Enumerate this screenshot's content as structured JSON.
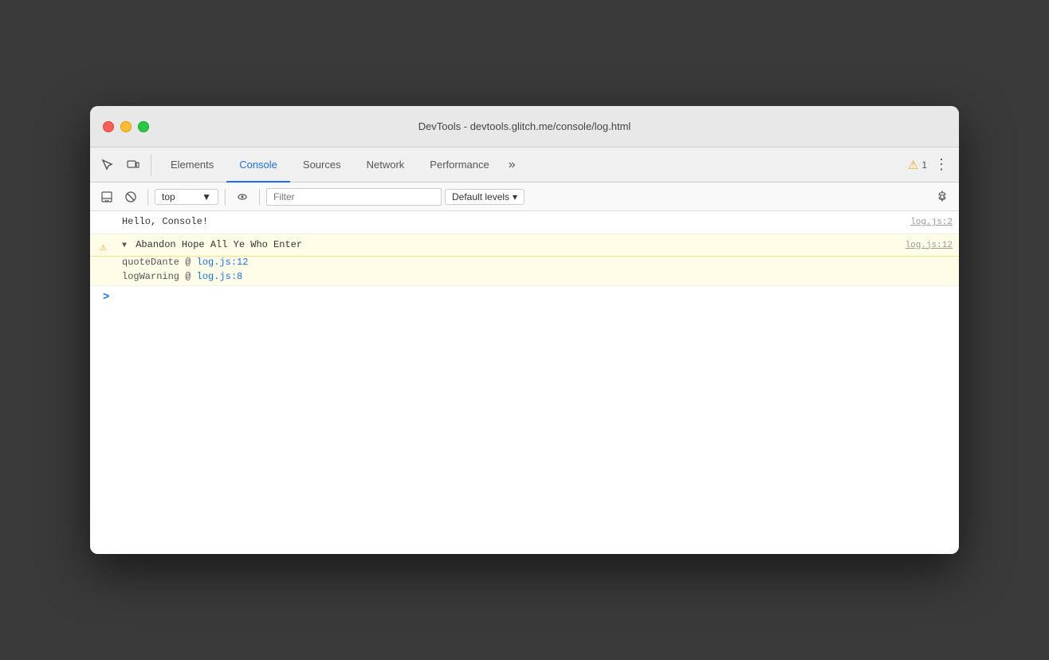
{
  "window": {
    "title": "DevTools - devtools.glitch.me/console/log.html"
  },
  "tabs": {
    "items": [
      {
        "id": "elements",
        "label": "Elements",
        "active": false
      },
      {
        "id": "console",
        "label": "Console",
        "active": true
      },
      {
        "id": "sources",
        "label": "Sources",
        "active": false
      },
      {
        "id": "network",
        "label": "Network",
        "active": false
      },
      {
        "id": "performance",
        "label": "Performance",
        "active": false
      }
    ],
    "more_label": "»",
    "warning_count": "1",
    "more_options_label": "⋮"
  },
  "console_toolbar": {
    "context_value": "top",
    "context_dropdown": "▼",
    "filter_placeholder": "Filter",
    "levels_label": "Default levels",
    "levels_dropdown": "▾"
  },
  "console_entries": [
    {
      "type": "info",
      "text": "Hello, Console!",
      "source": "log.js:2"
    },
    {
      "type": "warning",
      "text": "Abandon Hope All Ye Who Enter",
      "source": "log.js:12",
      "stack": [
        {
          "text": "quoteDante @ ",
          "link": "log.js:12"
        },
        {
          "text": "logWarning @ ",
          "link": "log.js:8"
        }
      ]
    }
  ],
  "console_input": {
    "prompt": ">",
    "placeholder": ""
  },
  "icons": {
    "inspector": "⬚",
    "device": "⬜",
    "clear": "🚫",
    "eye": "👁",
    "gear": "⚙",
    "warning_symbol": "⚠"
  }
}
